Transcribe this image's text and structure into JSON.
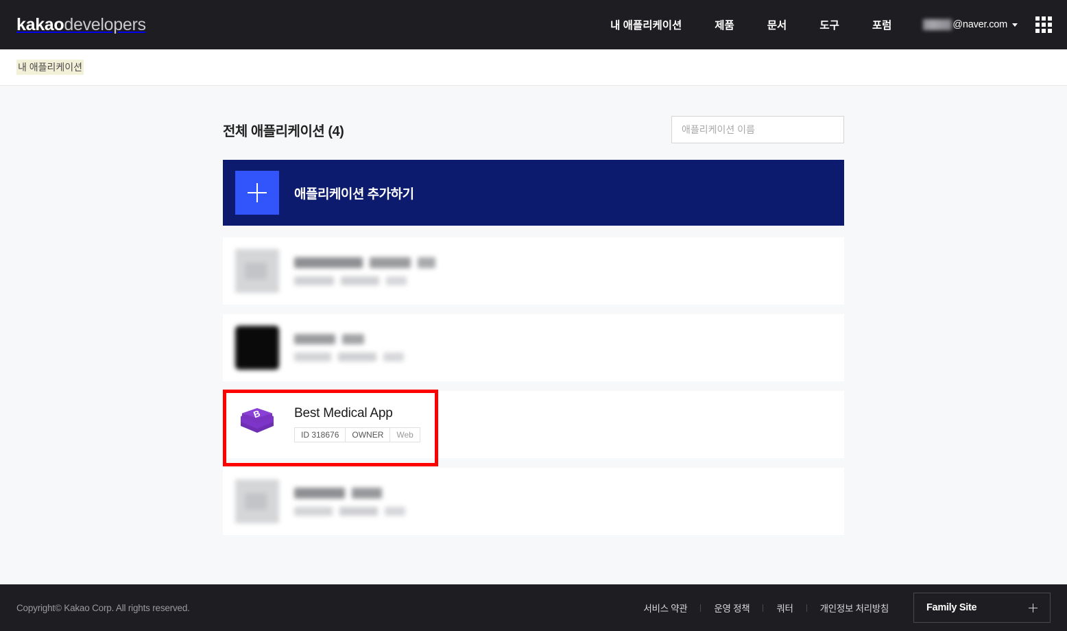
{
  "header": {
    "logo_strong": "kakao",
    "logo_light": "developers",
    "nav": [
      {
        "label": "내 애플리케이션"
      },
      {
        "label": "제품"
      },
      {
        "label": "문서"
      },
      {
        "label": "도구"
      },
      {
        "label": "포럼"
      }
    ],
    "account_email_suffix": "@naver.com",
    "apps_grid_icon": "grid-apps-icon"
  },
  "breadcrumb": {
    "items": [
      {
        "label": "내 애플리케이션"
      }
    ]
  },
  "main": {
    "list_title": "전체 애플리케이션 (4)",
    "search": {
      "placeholder": "애플리케이션 이름",
      "value": ""
    },
    "add_app_label": "애플리케이션 추가하기",
    "add_app_icon": "plus-icon",
    "apps": [
      {
        "name": "",
        "redacted": true,
        "thumb_style": "light",
        "badges": []
      },
      {
        "name": "",
        "redacted": true,
        "thumb_style": "dark",
        "badges": []
      },
      {
        "name": "Best Medical App",
        "redacted": false,
        "thumb_style": "bootstrap-logo",
        "highlighted": true,
        "badges": [
          {
            "label": "ID 318676",
            "muted": false
          },
          {
            "label": "OWNER",
            "muted": false
          },
          {
            "label": "Web",
            "muted": true
          }
        ]
      },
      {
        "name": "",
        "redacted": true,
        "thumb_style": "light",
        "badges": []
      }
    ]
  },
  "footer": {
    "copyright": "Copyright© Kakao Corp. All rights reserved.",
    "links": [
      {
        "label": "서비스 약관"
      },
      {
        "label": "운영 정책"
      },
      {
        "label": "쿼터"
      },
      {
        "label": "개인정보 처리방침"
      }
    ],
    "family_site_label": "Family Site",
    "family_site_icon": "plus-icon"
  },
  "colors": {
    "header_bg": "#1e1e22",
    "page_bg": "#f7f8f9",
    "add_app_bg": "#0d1b6e",
    "add_app_accent": "#3255fb",
    "highlight_border": "#ff0000",
    "bootstrap_purple": "#7a32c6"
  }
}
